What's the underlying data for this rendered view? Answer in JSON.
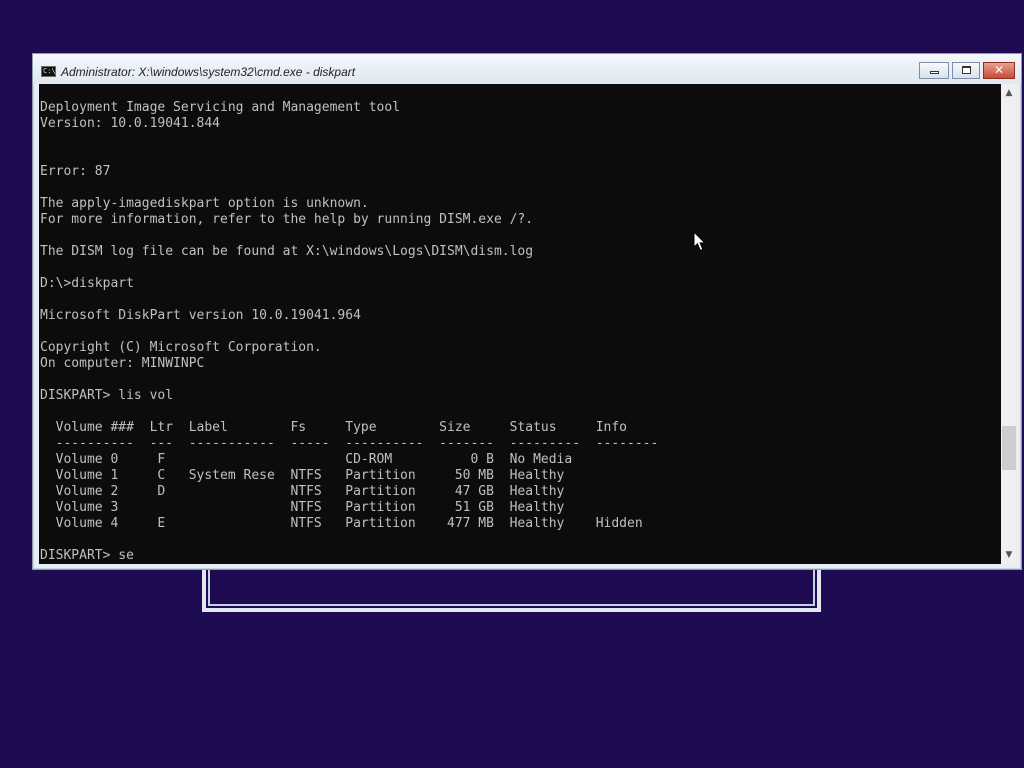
{
  "window": {
    "title": "Administrator: X:\\windows\\system32\\cmd.exe - diskpart",
    "icon": "console-icon",
    "icon_glyph": "C:\\",
    "minimize_icon": "minimize-icon",
    "maximize_icon": "restore-icon",
    "close_icon": "close-icon"
  },
  "console": {
    "lines": [
      "Deployment Image Servicing and Management tool",
      "Version: 10.0.19041.844",
      "",
      "",
      "Error: 87",
      "",
      "The apply-imagediskpart option is unknown.",
      "For more information, refer to the help by running DISM.exe /?.",
      "",
      "The DISM log file can be found at X:\\windows\\Logs\\DISM\\dism.log",
      "",
      "D:\\>diskpart",
      "",
      "Microsoft DiskPart version 10.0.19041.964",
      "",
      "Copyright (C) Microsoft Corporation.",
      "On computer: MINWINPC",
      "",
      "DISKPART> lis vol",
      "",
      "  Volume ###  Ltr  Label        Fs     Type        Size     Status     Info",
      "  ----------  ---  -----------  -----  ----------  -------  ---------  --------",
      "  Volume 0     F                       CD-ROM          0 B  No Media",
      "  Volume 1     C   System Rese  NTFS   Partition     50 MB  Healthy",
      "  Volume 2     D                NTFS   Partition     47 GB  Healthy",
      "  Volume 3                      NTFS   Partition     51 GB  Healthy",
      "  Volume 4     E                NTFS   Partition    477 MB  Healthy    Hidden",
      "",
      "DISKPART> se"
    ]
  },
  "scrollbar": {
    "up_icon": "scroll-up-arrow-icon",
    "down_icon": "scroll-down-arrow-icon",
    "up_glyph": "▲",
    "down_glyph": "▼"
  },
  "colors": {
    "desktop_background": "#1e0b52",
    "console_background": "#0c0c0c",
    "console_text": "#c0c0c0"
  }
}
